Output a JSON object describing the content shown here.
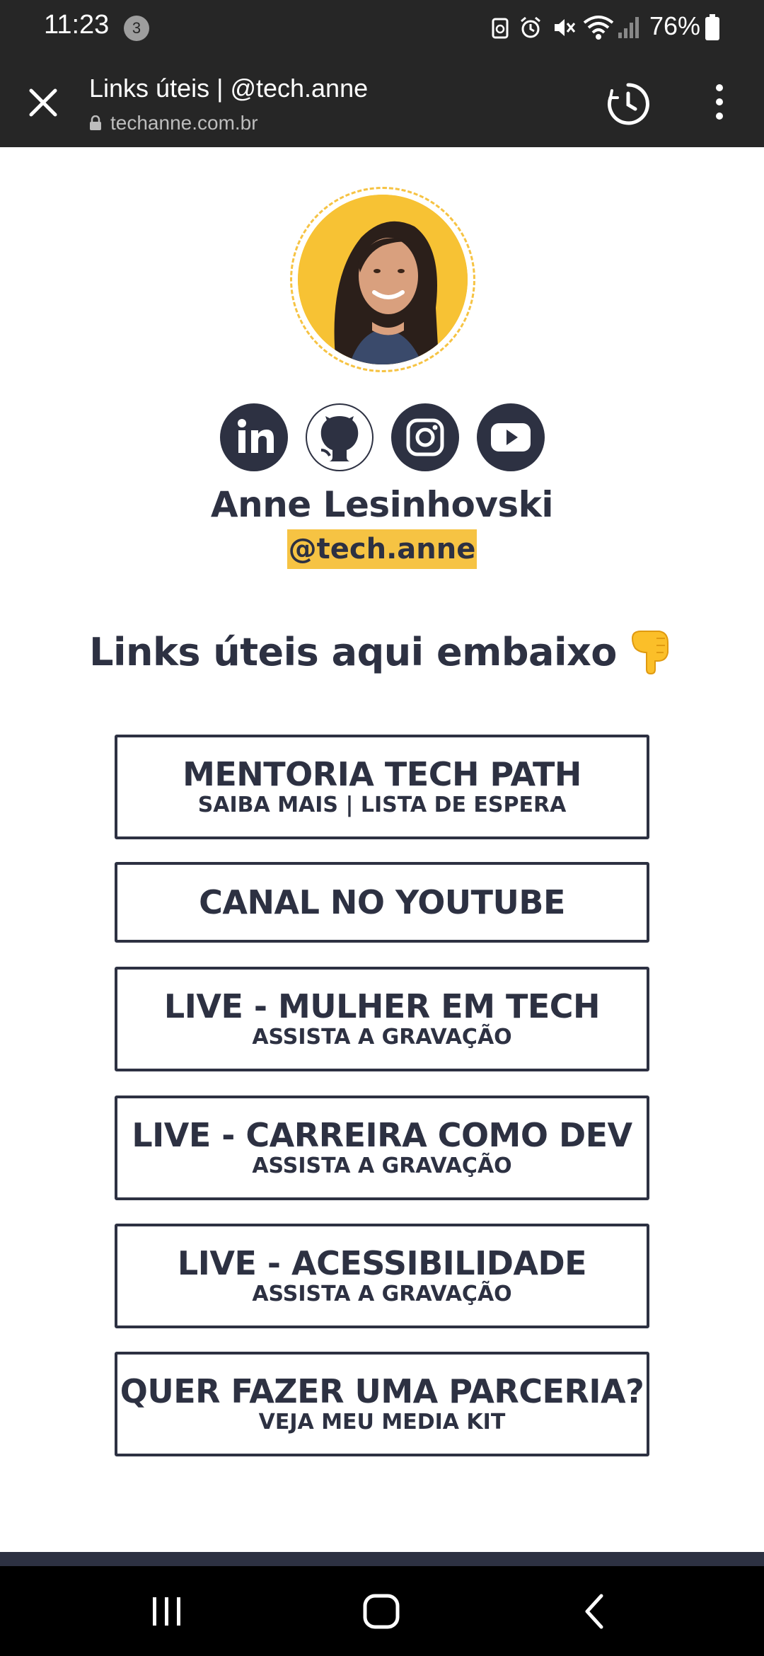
{
  "status_bar": {
    "time": "11:23",
    "notification_count": "3",
    "battery": "76%"
  },
  "browser": {
    "page_title": "Links úteis | @tech.anne",
    "url": "techanne.com.br"
  },
  "profile": {
    "name": "Anne Lesinhovski",
    "handle": "@tech.anne",
    "social_icons": [
      "linkedin-icon",
      "github-icon",
      "instagram-icon",
      "youtube-icon"
    ]
  },
  "section": {
    "heading": "Links úteis aqui embaixo",
    "heading_emoji": "pointing-down-emoji"
  },
  "links": [
    {
      "title": "MENTORIA TECH PATH",
      "subtitle": "SAIBA MAIS | LISTA DE ESPERA"
    },
    {
      "title": "CANAL NO YOUTUBE",
      "subtitle": ""
    },
    {
      "title": "LIVE - MULHER EM TECH",
      "subtitle": "ASSISTA A GRAVAÇÃO"
    },
    {
      "title": "LIVE - CARREIRA COMO DEV",
      "subtitle": "ASSISTA A GRAVAÇÃO"
    },
    {
      "title": "LIVE - ACESSIBILIDADE",
      "subtitle": "ASSISTA A GRAVAÇÃO"
    },
    {
      "title": "QUER FAZER UMA PARCERIA?",
      "subtitle": "VEJA MEU MEDIA KIT"
    }
  ],
  "colors": {
    "primary": "#2d3142",
    "accent": "#f6c343",
    "chrome": "#262626"
  }
}
